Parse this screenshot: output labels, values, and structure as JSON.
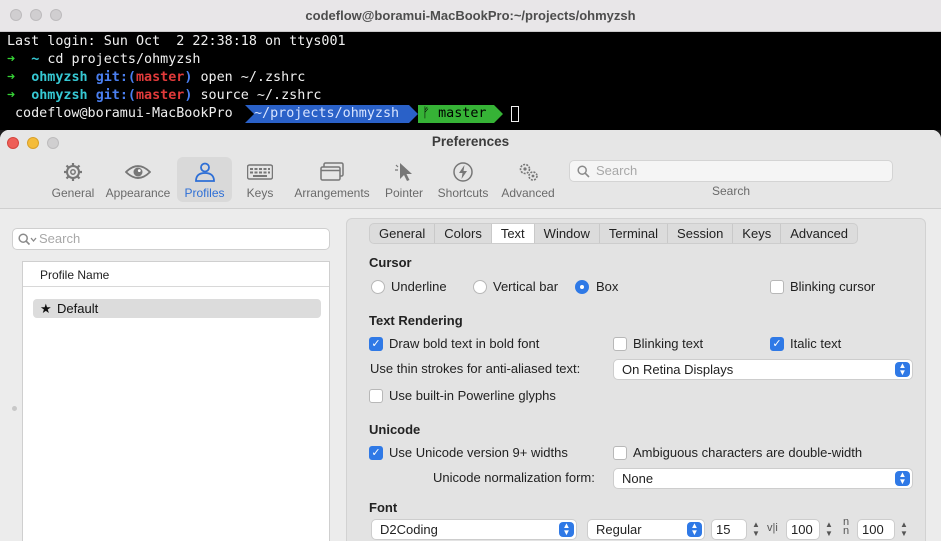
{
  "terminal": {
    "title": "codeflow@boramui-MacBookPro:~/projects/ohmyzsh",
    "last_login": "Last login: Sun Oct  2 22:38:18 on ttys001",
    "prompt_arrow": "➜",
    "home_dir": "~",
    "cmd1": "cd projects/ohmyzsh",
    "dir": "ohmyzsh",
    "git_prefix": "git:(",
    "branch": "master",
    "git_suffix": ")",
    "cmd2": "open ~/.zshrc",
    "cmd3": "source ~/.zshrc",
    "powerline": {
      "user_host": "codeflow@boramui-MacBookPro",
      "path": "~/projects/ohmyzsh",
      "branch_glyph": "ᚠ",
      "branch": "master"
    },
    "colors": {
      "green": "#36d336",
      "cyan": "#36c8d3",
      "blue": "#4a7ff0",
      "red": "#e03a3a"
    }
  },
  "preferences": {
    "title": "Preferences",
    "toolbar": [
      {
        "label": "General",
        "icon": "gear-icon"
      },
      {
        "label": "Appearance",
        "icon": "eye-icon"
      },
      {
        "label": "Profiles",
        "icon": "person-icon",
        "selected": true
      },
      {
        "label": "Keys",
        "icon": "keyboard-icon"
      },
      {
        "label": "Arrangements",
        "icon": "windows-stack-icon"
      },
      {
        "label": "Pointer",
        "icon": "pointer-icon"
      },
      {
        "label": "Shortcuts",
        "icon": "bolt-icon"
      },
      {
        "label": "Advanced",
        "icon": "gears-icon"
      }
    ],
    "search": {
      "placeholder": "Search",
      "label": "Search"
    },
    "profile_search": {
      "placeholder": "Search"
    },
    "profile_list": {
      "header": "Profile Name",
      "items": [
        {
          "name": "Default",
          "starred": true
        }
      ]
    },
    "tabs": [
      "General",
      "Colors",
      "Text",
      "Window",
      "Terminal",
      "Session",
      "Keys",
      "Advanced"
    ],
    "selected_tab": "Text",
    "cursor": {
      "heading": "Cursor",
      "options": [
        "Underline",
        "Vertical bar",
        "Box"
      ],
      "selected": "Box",
      "blinking_label": "Blinking cursor",
      "blinking": false
    },
    "text_rendering": {
      "heading": "Text Rendering",
      "bold_label": "Draw bold text in bold font",
      "bold": true,
      "blinking_text_label": "Blinking text",
      "blinking_text": false,
      "italic_label": "Italic text",
      "italic": true,
      "thin_strokes_label": "Use thin strokes for anti-aliased text:",
      "thin_strokes_value": "On Retina Displays",
      "powerline_label": "Use built-in Powerline glyphs",
      "powerline": false
    },
    "unicode": {
      "heading": "Unicode",
      "v9_label": "Use Unicode version 9+ widths",
      "v9": true,
      "ambiguous_label": "Ambiguous characters are double-width",
      "ambiguous": false,
      "normalization_label": "Unicode normalization form:",
      "normalization_value": "None"
    },
    "font": {
      "heading": "Font",
      "family": "D2Coding",
      "weight": "Regular",
      "size": "15",
      "h_spacing": "100",
      "v_spacing": "100"
    },
    "colors": {
      "accent": "#2f79e6"
    }
  }
}
